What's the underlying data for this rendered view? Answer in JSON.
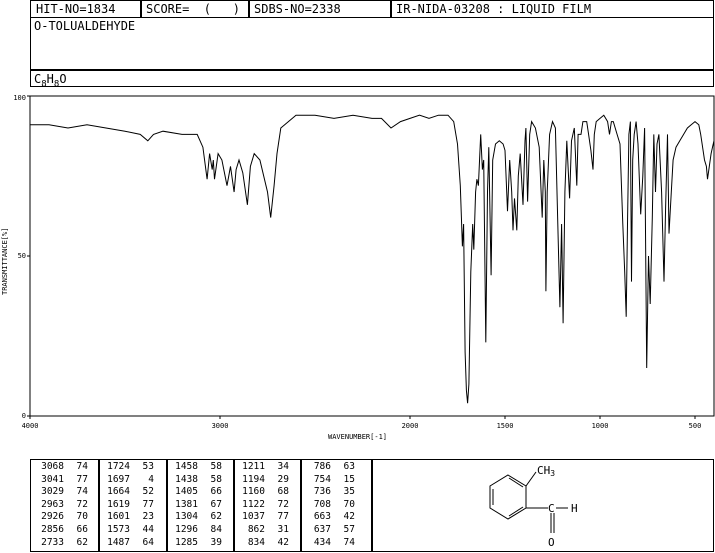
{
  "header": {
    "hit_no": "HIT-NO=1834",
    "score": "SCORE=  (   )",
    "sdbs_no": "SDBS-NO=2338",
    "ir_info": "IR-NIDA-03208 : LIQUID FILM"
  },
  "compound": {
    "name": "O-TOLUALDEHYDE",
    "formula_parts": [
      "C",
      "8",
      "H",
      "8",
      "O"
    ]
  },
  "chart_data": {
    "type": "line",
    "xlabel": "WAVENUMBER[-1]",
    "ylabel": "TRANSMITTANCE[%]",
    "xlim": [
      4000,
      400
    ],
    "ylim": [
      0,
      100
    ],
    "x_ticks": [
      4000,
      3000,
      2000,
      1500,
      1000,
      500
    ],
    "y_ticks": [
      0,
      50,
      100
    ],
    "grid": false,
    "series": [
      {
        "points": [
          [
            4000,
            91
          ],
          [
            3900,
            91
          ],
          [
            3800,
            90
          ],
          [
            3700,
            91
          ],
          [
            3600,
            90
          ],
          [
            3500,
            89
          ],
          [
            3420,
            88
          ],
          [
            3380,
            86
          ],
          [
            3350,
            88
          ],
          [
            3300,
            89
          ],
          [
            3200,
            88
          ],
          [
            3120,
            88
          ],
          [
            3090,
            84
          ],
          [
            3068,
            74
          ],
          [
            3055,
            82
          ],
          [
            3041,
            77
          ],
          [
            3035,
            80
          ],
          [
            3029,
            74
          ],
          [
            3010,
            82
          ],
          [
            2990,
            80
          ],
          [
            2963,
            72
          ],
          [
            2945,
            78
          ],
          [
            2926,
            70
          ],
          [
            2915,
            77
          ],
          [
            2900,
            80
          ],
          [
            2880,
            76
          ],
          [
            2856,
            66
          ],
          [
            2840,
            78
          ],
          [
            2820,
            82
          ],
          [
            2790,
            80
          ],
          [
            2770,
            75
          ],
          [
            2750,
            70
          ],
          [
            2733,
            62
          ],
          [
            2715,
            72
          ],
          [
            2700,
            82
          ],
          [
            2680,
            90
          ],
          [
            2600,
            94
          ],
          [
            2500,
            94
          ],
          [
            2400,
            93
          ],
          [
            2300,
            94
          ],
          [
            2200,
            93
          ],
          [
            2150,
            93
          ],
          [
            2100,
            90
          ],
          [
            2050,
            92
          ],
          [
            2000,
            93
          ],
          [
            1950,
            94
          ],
          [
            1900,
            93
          ],
          [
            1850,
            94
          ],
          [
            1800,
            94
          ],
          [
            1770,
            92
          ],
          [
            1750,
            85
          ],
          [
            1735,
            72
          ],
          [
            1724,
            53
          ],
          [
            1718,
            60
          ],
          [
            1710,
            20
          ],
          [
            1703,
            8
          ],
          [
            1697,
            4
          ],
          [
            1690,
            10
          ],
          [
            1680,
            45
          ],
          [
            1670,
            60
          ],
          [
            1664,
            52
          ],
          [
            1655,
            70
          ],
          [
            1648,
            74
          ],
          [
            1640,
            72
          ],
          [
            1628,
            88
          ],
          [
            1619,
            77
          ],
          [
            1612,
            80
          ],
          [
            1601,
            23
          ],
          [
            1592,
            70
          ],
          [
            1585,
            84
          ],
          [
            1573,
            44
          ],
          [
            1565,
            80
          ],
          [
            1550,
            85
          ],
          [
            1530,
            86
          ],
          [
            1510,
            85
          ],
          [
            1500,
            83
          ],
          [
            1487,
            64
          ],
          [
            1475,
            80
          ],
          [
            1465,
            70
          ],
          [
            1458,
            58
          ],
          [
            1450,
            68
          ],
          [
            1438,
            58
          ],
          [
            1430,
            75
          ],
          [
            1420,
            82
          ],
          [
            1405,
            66
          ],
          [
            1395,
            86
          ],
          [
            1390,
            90
          ],
          [
            1381,
            67
          ],
          [
            1370,
            88
          ],
          [
            1360,
            92
          ],
          [
            1340,
            90
          ],
          [
            1320,
            84
          ],
          [
            1304,
            62
          ],
          [
            1296,
            80
          ],
          [
            1288,
            70
          ],
          [
            1285,
            39
          ],
          [
            1278,
            70
          ],
          [
            1265,
            88
          ],
          [
            1250,
            92
          ],
          [
            1235,
            90
          ],
          [
            1222,
            60
          ],
          [
            1211,
            34
          ],
          [
            1202,
            60
          ],
          [
            1194,
            29
          ],
          [
            1185,
            70
          ],
          [
            1175,
            86
          ],
          [
            1160,
            68
          ],
          [
            1150,
            86
          ],
          [
            1135,
            90
          ],
          [
            1122,
            72
          ],
          [
            1115,
            88
          ],
          [
            1100,
            88
          ],
          [
            1090,
            92
          ],
          [
            1070,
            92
          ],
          [
            1060,
            88
          ],
          [
            1048,
            83
          ],
          [
            1037,
            77
          ],
          [
            1030,
            88
          ],
          [
            1020,
            92
          ],
          [
            1000,
            93
          ],
          [
            980,
            94
          ],
          [
            960,
            92
          ],
          [
            950,
            88
          ],
          [
            940,
            92
          ],
          [
            930,
            92
          ],
          [
            910,
            88
          ],
          [
            895,
            85
          ],
          [
            880,
            60
          ],
          [
            870,
            45
          ],
          [
            862,
            31
          ],
          [
            855,
            60
          ],
          [
            848,
            88
          ],
          [
            840,
            92
          ],
          [
            834,
            42
          ],
          [
            828,
            80
          ],
          [
            820,
            88
          ],
          [
            810,
            92
          ],
          [
            800,
            85
          ],
          [
            786,
            63
          ],
          [
            775,
            75
          ],
          [
            765,
            90
          ],
          [
            754,
            15
          ],
          [
            745,
            50
          ],
          [
            736,
            35
          ],
          [
            725,
            62
          ],
          [
            717,
            88
          ],
          [
            708,
            70
          ],
          [
            700,
            85
          ],
          [
            690,
            88
          ],
          [
            676,
            70
          ],
          [
            663,
            42
          ],
          [
            655,
            65
          ],
          [
            645,
            88
          ],
          [
            637,
            57
          ],
          [
            625,
            70
          ],
          [
            615,
            80
          ],
          [
            600,
            84
          ],
          [
            580,
            86
          ],
          [
            560,
            88
          ],
          [
            540,
            90
          ],
          [
            520,
            91
          ],
          [
            500,
            92
          ],
          [
            480,
            91
          ],
          [
            470,
            88
          ],
          [
            460,
            84
          ],
          [
            450,
            80
          ],
          [
            440,
            78
          ],
          [
            434,
            74
          ],
          [
            425,
            78
          ],
          [
            415,
            82
          ],
          [
            408,
            84
          ],
          [
            400,
            86
          ]
        ]
      }
    ]
  },
  "peak_table": {
    "columns": [
      [
        [
          3068,
          74
        ],
        [
          3041,
          77
        ],
        [
          3029,
          74
        ],
        [
          2963,
          72
        ],
        [
          2926,
          70
        ],
        [
          2856,
          66
        ],
        [
          2733,
          62
        ]
      ],
      [
        [
          1724,
          53
        ],
        [
          1697,
          4
        ],
        [
          1664,
          52
        ],
        [
          1619,
          77
        ],
        [
          1601,
          23
        ],
        [
          1573,
          44
        ],
        [
          1487,
          64
        ]
      ],
      [
        [
          1458,
          58
        ],
        [
          1438,
          58
        ],
        [
          1405,
          66
        ],
        [
          1381,
          67
        ],
        [
          1304,
          62
        ],
        [
          1296,
          84
        ],
        [
          1285,
          39
        ]
      ],
      [
        [
          1211,
          34
        ],
        [
          1194,
          29
        ],
        [
          1160,
          68
        ],
        [
          1122,
          72
        ],
        [
          1037,
          77
        ],
        [
          862,
          31
        ],
        [
          834,
          42
        ]
      ],
      [
        [
          786,
          63
        ],
        [
          754,
          15
        ],
        [
          736,
          35
        ],
        [
          708,
          70
        ],
        [
          663,
          42
        ],
        [
          637,
          57
        ],
        [
          434,
          74
        ]
      ]
    ]
  },
  "structure": {
    "methyl_label": "CH",
    "methyl_sub": "3",
    "h_label": "H",
    "o_label": "O",
    "c_label": "C"
  }
}
